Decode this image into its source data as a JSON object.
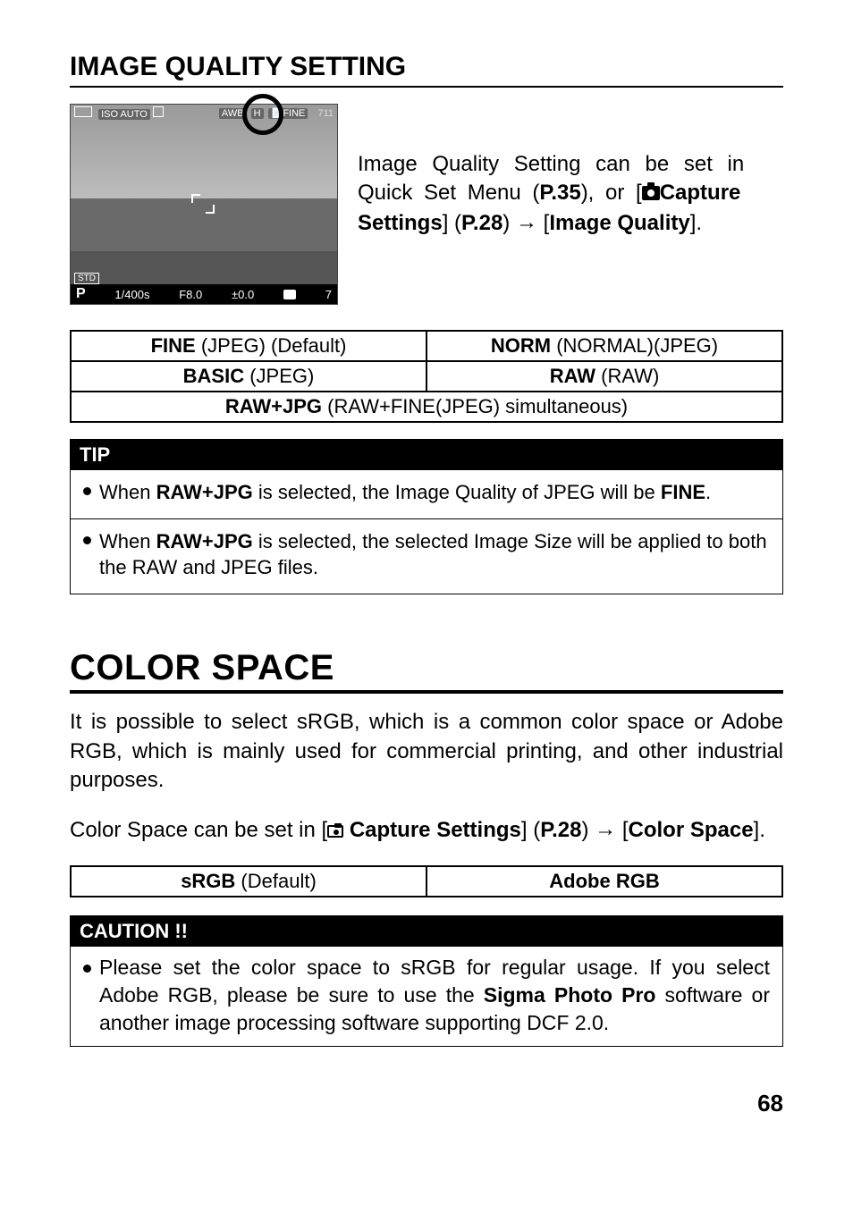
{
  "section1": {
    "heading": "IMAGE QUALITY SETTING",
    "camshot_top_left_iso": "ISO",
    "camshot_top_left_auto": "AUTO",
    "camshot_top_right_awb": "AWB",
    "camshot_top_right_h": "H",
    "camshot_top_right_fine": "FINE",
    "camshot_top_right_count": "711",
    "camshot_std": "STD",
    "camshot_bottom_p": "P",
    "camshot_bottom_shutter": "1/400s",
    "camshot_bottom_f": "F8.0",
    "camshot_bottom_ev": "±0.0",
    "camshot_bottom_shots": "7",
    "para_l1_a": "Image Quality Setting can be set in",
    "para_l2_a": "Quick Set Menu (",
    "para_l2_b": "P.35",
    "para_l2_c": "), or [",
    "para_l2_d": "Capture",
    "para_l3_a": "Settings",
    "para_l3_b": "] (",
    "para_l3_c": "P.28",
    "para_l3_d": ") ",
    "para_l3_arrow": "→",
    "para_l3_e": " [",
    "para_l3_f": "Image Quality",
    "para_l3_g": "].",
    "table_r1c1_b": "FINE",
    "table_r1c1_t": " (JPEG) (Default)",
    "table_r1c2_b": "NORM",
    "table_r1c2_t": " (NORMAL)(JPEG)",
    "table_r2c1_b": "BASIC",
    "table_r2c1_t": "   (JPEG)",
    "table_r2c2_b": "RAW",
    "table_r2c2_t": "   (RAW)",
    "table_r3_b": "RAW+JPG",
    "table_r3_t": "   (RAW+FINE(JPEG) simultaneous)",
    "tip_label": "TIP",
    "tip1_a": "When ",
    "tip1_b": "RAW+JPG",
    "tip1_c": " is selected, the Image Quality of JPEG will be ",
    "tip1_d": "FINE",
    "tip1_e": ".",
    "tip2_a": "When ",
    "tip2_b": "RAW+JPG",
    "tip2_c": " is selected, the selected Image Size will be applied to both the RAW and JPEG files."
  },
  "section2": {
    "heading": "COLOR SPACE",
    "para1": "It is possible to select sRGB, which is a common color space or Adobe RGB, which is mainly used for commercial printing, and other industrial purposes.",
    "para2_a": "Color Space can be set in [",
    "para2_b": " Capture Settings",
    "para2_c": "] (",
    "para2_d": "P.28",
    "para2_e": ") ",
    "para2_arrow": "→",
    "para2_f": " [",
    "para2_g": "Color Space",
    "para2_h": "].",
    "table_c1_b": "sRGB",
    "table_c1_t": " (Default)",
    "table_c2_b": "Adobe RGB",
    "caution_label": "CAUTION !!",
    "caution_a": "Please set the color space to sRGB for regular usage. If you select Adobe RGB, please be sure to use the ",
    "caution_b": "Sigma Photo Pro",
    "caution_c": " software or another image processing software supporting DCF 2.0."
  },
  "page_number": "68"
}
